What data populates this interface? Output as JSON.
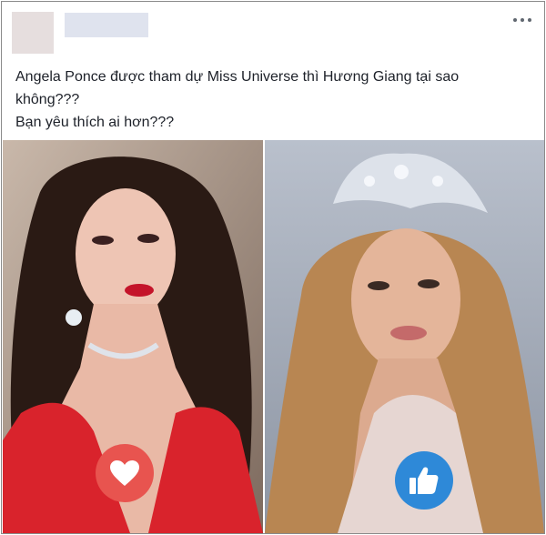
{
  "post": {
    "caption_lines": [
      "Angela Ponce được tham dự Miss Universe thì Hương Giang tại sao",
      "không???",
      "Bạn yêu thích ai hơn???"
    ]
  },
  "photos": [
    {
      "subject": "woman-red-dress",
      "reaction_icon": "heart-icon",
      "reaction_color": "#e8544f"
    },
    {
      "subject": "woman-crown",
      "reaction_icon": "thumbs-up-icon",
      "reaction_color": "#2e89d8"
    }
  ],
  "colors": {
    "text": "#1d2129",
    "border": "#8a8a8a",
    "like": "#2e89d8",
    "love": "#e8544f"
  }
}
